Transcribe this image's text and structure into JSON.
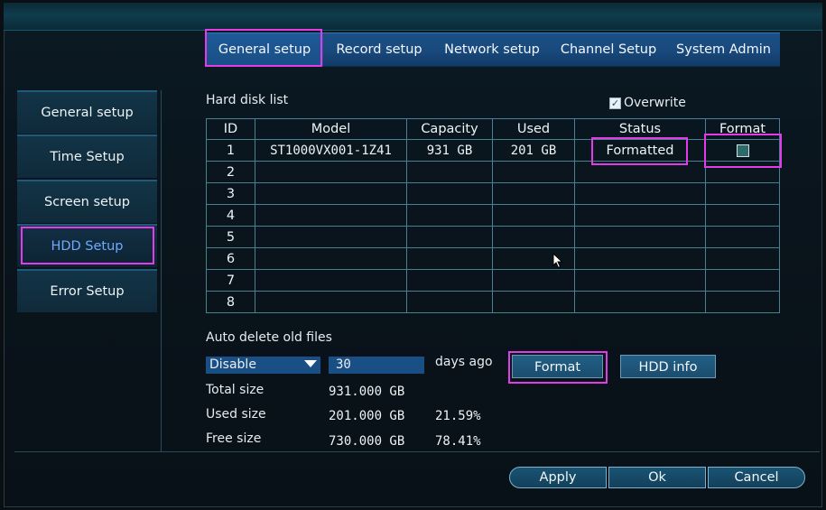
{
  "tabs": [
    "General setup",
    "Record setup",
    "Network setup",
    "Channel Setup",
    "System Admin"
  ],
  "sidebar": [
    "General setup",
    "Time Setup",
    "Screen setup",
    "HDD Setup",
    "Error Setup"
  ],
  "hdd": {
    "title": "Hard disk list",
    "overwrite_label": "Overwrite",
    "overwrite_checked": true,
    "columns": [
      "ID",
      "Model",
      "Capacity",
      "Used",
      "Status",
      "Format"
    ],
    "rows": [
      {
        "id": "1",
        "model": "ST1000VX001-1Z41",
        "capacity": "931 GB",
        "used": "201 GB",
        "status": "Formatted",
        "format": "checkbox"
      },
      {
        "id": "2",
        "model": "",
        "capacity": "",
        "used": "",
        "status": "",
        "format": ""
      },
      {
        "id": "3",
        "model": "",
        "capacity": "",
        "used": "",
        "status": "",
        "format": ""
      },
      {
        "id": "4",
        "model": "",
        "capacity": "",
        "used": "",
        "status": "",
        "format": ""
      },
      {
        "id": "5",
        "model": "",
        "capacity": "",
        "used": "",
        "status": "",
        "format": ""
      },
      {
        "id": "6",
        "model": "",
        "capacity": "",
        "used": "",
        "status": "",
        "format": ""
      },
      {
        "id": "7",
        "model": "",
        "capacity": "",
        "used": "",
        "status": "",
        "format": ""
      },
      {
        "id": "8",
        "model": "",
        "capacity": "",
        "used": "",
        "status": "",
        "format": ""
      }
    ]
  },
  "auto_delete": {
    "label": "Auto delete old files",
    "select_value": "Disable",
    "days_value": "30",
    "days_suffix": "days ago"
  },
  "buttons": {
    "format": "Format",
    "hdd_info": "HDD info",
    "apply": "Apply",
    "ok": "Ok",
    "cancel": "Cancel"
  },
  "sizes": {
    "total_label": "Total size",
    "total_value": "931.000 GB",
    "used_label": "Used size",
    "used_value": "201.000 GB",
    "used_pct": "21.59%",
    "free_label": "Free size",
    "free_value": "730.000 GB",
    "free_pct": "78.41%"
  },
  "colors": {
    "highlight": "#e23be8",
    "tab_bar": "#1a4f86",
    "active_sidebar_text": "#6ea9ff"
  }
}
